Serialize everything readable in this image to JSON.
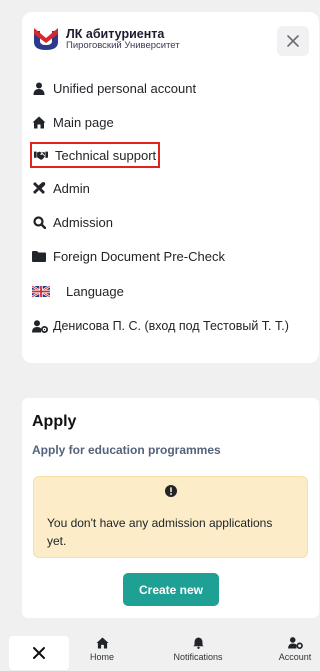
{
  "brand": {
    "title": "ЛК абитуриента",
    "subtitle": "Пироговский Университет",
    "logo_icon": "university-logo",
    "colors": {
      "red": "#d8272d",
      "navy": "#2b3a8c"
    }
  },
  "menu": {
    "close_icon": "close-icon",
    "items": [
      {
        "label": "Unified personal account",
        "icon": "user-icon"
      },
      {
        "label": "Main page",
        "icon": "home-icon"
      },
      {
        "label": "Technical support",
        "icon": "handshake-icon",
        "highlighted": true
      },
      {
        "label": "Admin",
        "icon": "tools-icon"
      },
      {
        "label": "Admission",
        "icon": "search-icon"
      },
      {
        "label": "Foreign Document Pre-Check",
        "icon": "folder-icon"
      },
      {
        "label": "Language",
        "icon": "uk-flag-icon"
      },
      {
        "label": "Денисова П. С. (вход под Тестовый Т. Т.)",
        "icon": "user-gear-icon"
      }
    ]
  },
  "apply": {
    "title": "Apply",
    "subtitle": "Apply for education programmes",
    "warning_icon": "exclamation-circle-icon",
    "warning_text": "You don't have any admission applications yet.",
    "create_button": "Create new",
    "colors": {
      "warning_bg": "#fcecc7",
      "button": "#1fa094"
    }
  },
  "bottom_nav": {
    "close_icon": "close-icon",
    "items": [
      {
        "label": "Home",
        "icon": "home-icon"
      },
      {
        "label": "Notifications",
        "icon": "bell-icon"
      },
      {
        "label": "Account",
        "icon": "user-gear-icon"
      }
    ]
  }
}
